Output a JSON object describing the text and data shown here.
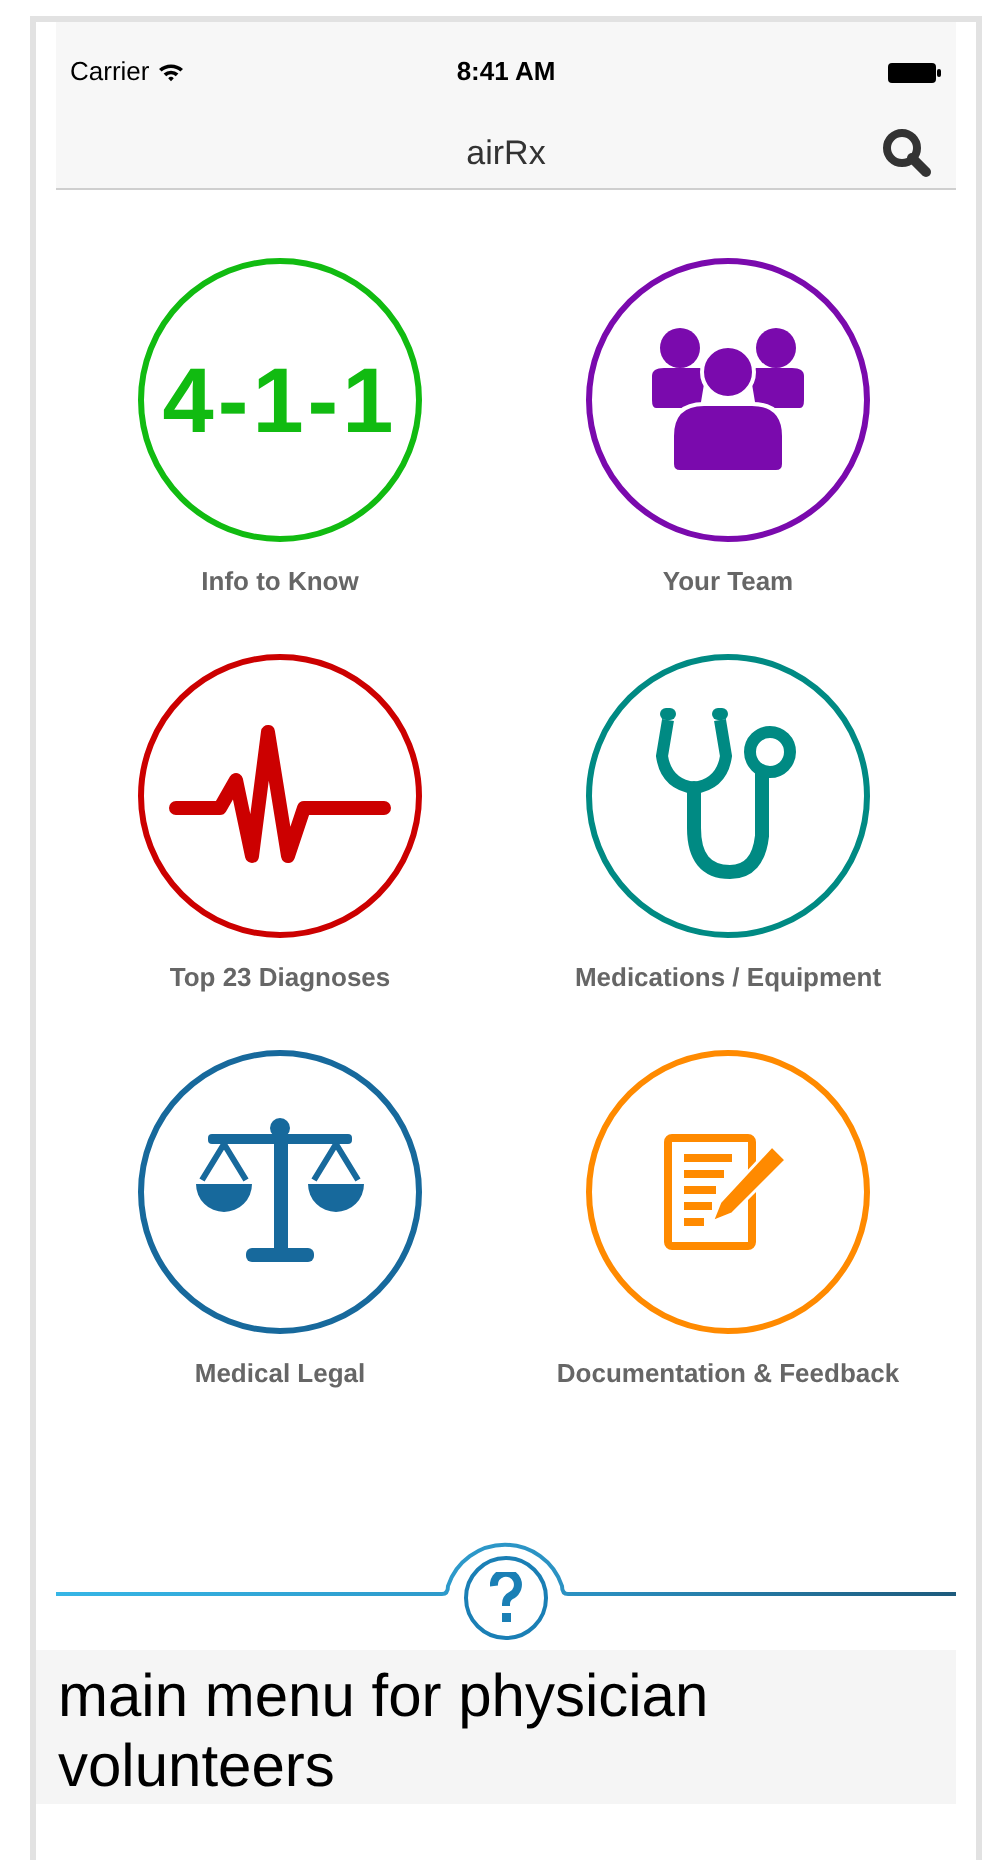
{
  "status_bar": {
    "carrier": "Carrier",
    "time": "8:41 AM"
  },
  "nav_bar": {
    "title": "airRx"
  },
  "menu_items": [
    {
      "label": "Info to Know",
      "kind": "text",
      "icon_text": "4-1-1",
      "color": "#11bb11"
    },
    {
      "label": "Your Team",
      "kind": "team",
      "color": "#7a0aad"
    },
    {
      "label": "Top 23 Diagnoses",
      "kind": "pulse",
      "color": "#cc0000"
    },
    {
      "label": "Medications / Equipment",
      "kind": "stethoscope",
      "color": "#008a83"
    },
    {
      "label": "Medical Legal",
      "kind": "scales",
      "color": "#17699c"
    },
    {
      "label": "Documentation & Feedback",
      "kind": "notes",
      "color": "#ff8a00"
    }
  ],
  "caption": "main menu for physician volunteers"
}
